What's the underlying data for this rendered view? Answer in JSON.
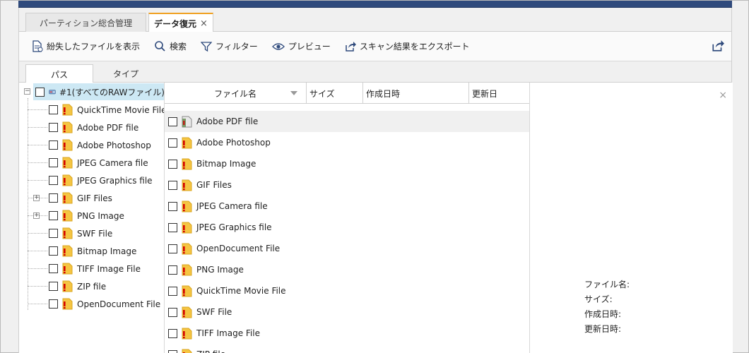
{
  "tabs": [
    {
      "label": "パーティション総合管理"
    },
    {
      "label": "データ復元",
      "close": "×"
    }
  ],
  "toolbar": {
    "show_lost": "紛失したファイルを表示",
    "search": "検索",
    "filter": "フィルター",
    "preview": "プレビュー",
    "export_scan": "スキャン結果をエクスポート"
  },
  "subtabs": {
    "path": "パス",
    "type": "タイプ"
  },
  "tree": {
    "root": {
      "label": "#1(すべてのRAWファイル)",
      "expander": "−"
    },
    "items": [
      {
        "label": "QuickTime Movie File"
      },
      {
        "label": "Adobe PDF file"
      },
      {
        "label": "Adobe Photoshop"
      },
      {
        "label": "JPEG Camera file"
      },
      {
        "label": "JPEG Graphics file"
      },
      {
        "label": "GIF Files",
        "expander": "+"
      },
      {
        "label": "PNG Image",
        "expander": "+"
      },
      {
        "label": "SWF File"
      },
      {
        "label": "Bitmap Image"
      },
      {
        "label": "TIFF Image File"
      },
      {
        "label": "ZIP file"
      },
      {
        "label": "OpenDocument File"
      }
    ]
  },
  "list": {
    "columns": {
      "name": "ファイル名",
      "size": "サイズ",
      "created": "作成日時",
      "modified": "更新日"
    },
    "rows": [
      {
        "name": "Adobe PDF file"
      },
      {
        "name": "Adobe Photoshop"
      },
      {
        "name": "Bitmap Image"
      },
      {
        "name": "GIF Files"
      },
      {
        "name": "JPEG Camera file"
      },
      {
        "name": "JPEG Graphics file"
      },
      {
        "name": "OpenDocument File"
      },
      {
        "name": "PNG Image"
      },
      {
        "name": "QuickTime Movie File"
      },
      {
        "name": "SWF File"
      },
      {
        "name": "TIFF Image File"
      },
      {
        "name": "ZIP file"
      }
    ]
  },
  "preview": {
    "close": "×",
    "filename_label": "ファイル名:",
    "size_label": "サイズ:",
    "created_label": "作成日時:",
    "modified_label": "更新日時:"
  },
  "colors": {
    "accent": "#f0a020",
    "folder": "#f5c542",
    "error": "#d40000",
    "selected": "#cde8f4",
    "titlebar": "#2f4a7c"
  }
}
